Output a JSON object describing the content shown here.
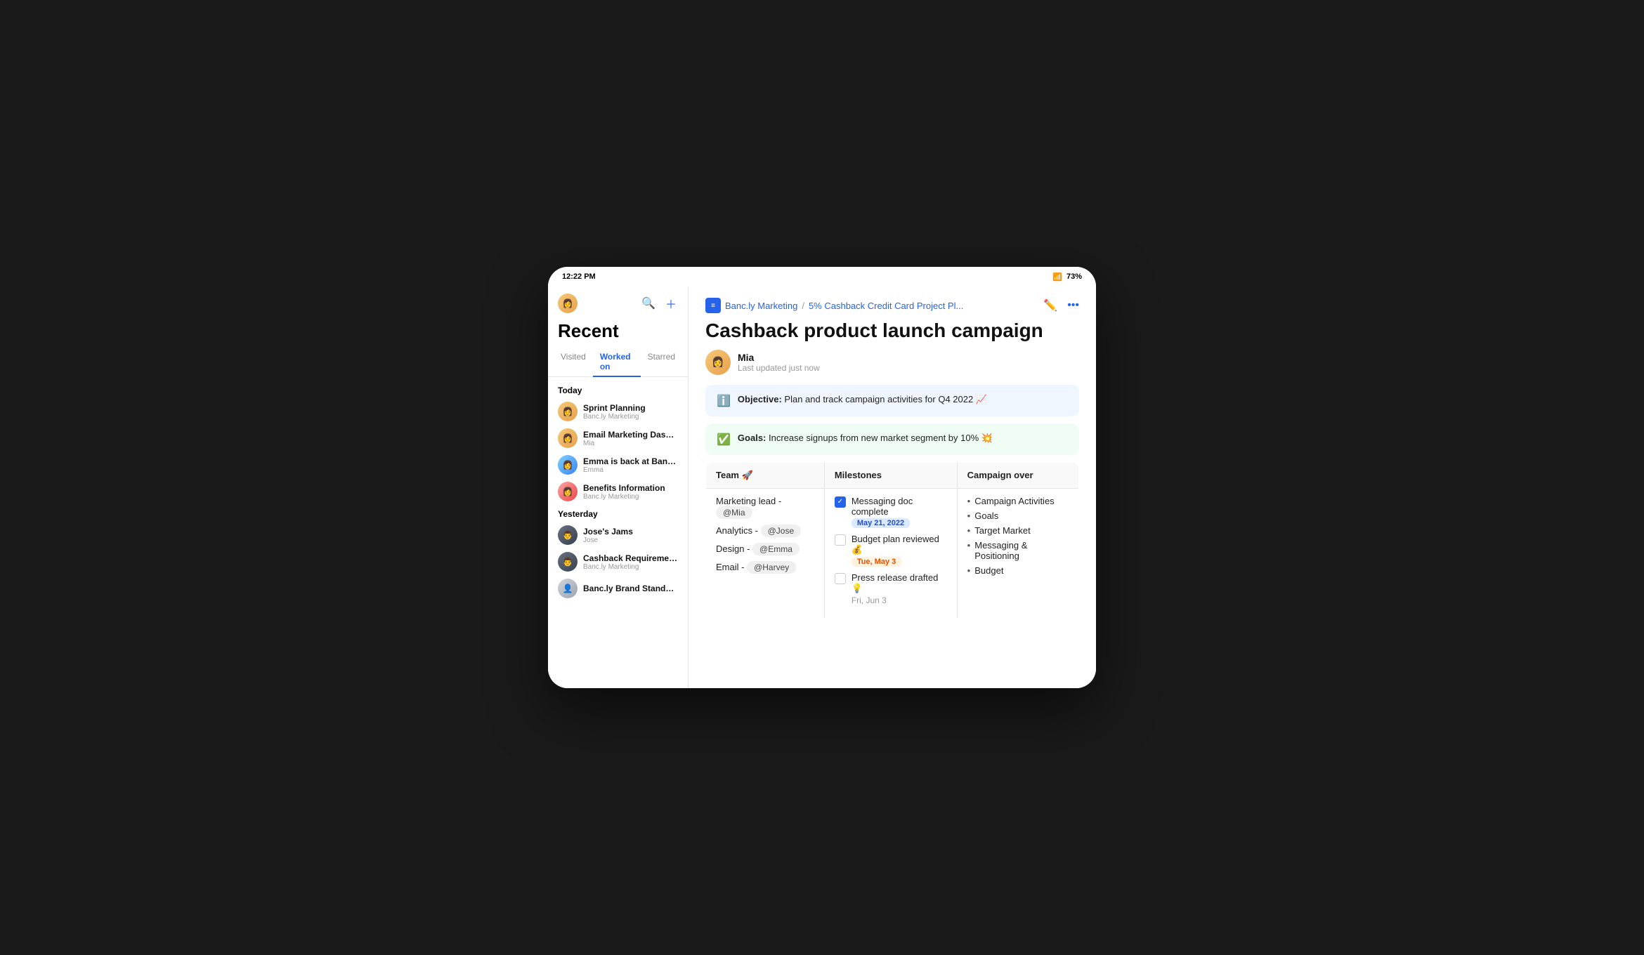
{
  "statusBar": {
    "time": "12:22 PM",
    "wifi": "wifi",
    "battery": "73%"
  },
  "sidebar": {
    "title": "Recent",
    "tabs": [
      {
        "label": "Visited",
        "active": false
      },
      {
        "label": "Worked on",
        "active": true
      },
      {
        "label": "Starred",
        "active": false
      }
    ],
    "today": {
      "label": "Today",
      "items": [
        {
          "name": "Sprint Planning",
          "sub": "Banc.ly Marketing",
          "avatar": "mia"
        },
        {
          "name": "Email Marketing Dashboards",
          "sub": "Mia",
          "avatar": "mia"
        },
        {
          "name": "Emma is back at Banc.ly",
          "sub": "Emma",
          "avatar": "emma"
        },
        {
          "name": "Benefits Information",
          "sub": "Banc.ly Marketing",
          "avatar": "woman2"
        }
      ]
    },
    "yesterday": {
      "label": "Yesterday",
      "items": [
        {
          "name": "Jose's Jams",
          "sub": "Jose",
          "avatar": "jose"
        },
        {
          "name": "Cashback Requirements",
          "sub": "Banc.ly Marketing",
          "avatar": "jose"
        },
        {
          "name": "Banc.ly Brand Standards",
          "sub": "",
          "avatar": "generic"
        }
      ]
    }
  },
  "header": {
    "breadcrumb": {
      "icon": "≡",
      "workspace": "Banc.ly Marketing",
      "separator": "/",
      "page": "5% Cashback Credit Card Project Pl..."
    },
    "editIcon": "✏",
    "moreIcon": "•••"
  },
  "page": {
    "title": "Cashback product launch campaign",
    "author": "Mia",
    "lastUpdated": "Last updated just now",
    "objective": {
      "label": "Objective:",
      "text": "Plan and track campaign activities for Q4 2022 📈"
    },
    "goals": {
      "label": "Goals:",
      "text": "Increase signups from new market segment by 10% 💥"
    },
    "table": {
      "headers": [
        "Team 🚀",
        "Milestones",
        "Campaign over"
      ],
      "teamRows": [
        {
          "role": "Marketing lead -",
          "mention": "@Mia"
        },
        {
          "role": "Analytics -",
          "mention": "@Jose"
        },
        {
          "role": "Design -",
          "mention": "@Emma"
        },
        {
          "role": "Email -",
          "mention": "@Harvey"
        }
      ],
      "milestones": [
        {
          "checked": true,
          "text": "Messaging doc complete",
          "date": "May 21, 2022",
          "dateType": "blue"
        },
        {
          "checked": false,
          "text": "Budget plan reviewed 💰",
          "date": "Tue, May 3",
          "dateType": "orange"
        },
        {
          "checked": false,
          "text": "Press release drafted 💡",
          "date": "Fri, Jun 3",
          "dateType": ""
        }
      ],
      "campaignItems": [
        "Campaign Activities",
        "Goals",
        "Target Market",
        "Messaging & Positioning",
        "Budget"
      ]
    }
  }
}
